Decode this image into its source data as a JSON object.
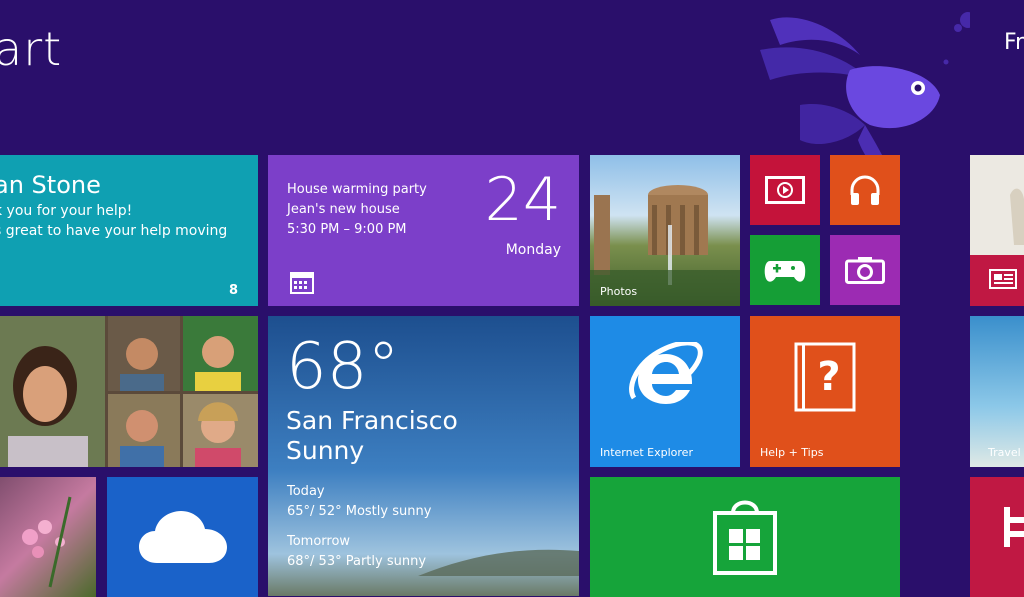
{
  "screen": {
    "title": "art",
    "user_name_partial": "Fr"
  },
  "tiles": {
    "mail": {
      "from": "an Stone",
      "line1": "k you for your help!",
      "line2": "s great to have your help moving",
      "count": "8"
    },
    "calendar": {
      "event": "House warming party",
      "location": "Jean's new house",
      "time": "5:30 PM – 9:00 PM",
      "day": "24",
      "weekday": "Monday"
    },
    "photos": {
      "label": "Photos"
    },
    "weather": {
      "temp": "68°",
      "city": "San Francisco",
      "condition": "Sunny",
      "today_label": "Today",
      "today_forecast": "65°/ 52° Mostly sunny",
      "tomorrow_label": "Tomorrow",
      "tomorrow_forecast": "68°/ 53° Partly sunny"
    },
    "ie": {
      "label": "Internet Explorer"
    },
    "help": {
      "label": "Help + Tips"
    },
    "travel": {
      "label": "Travel"
    }
  },
  "icons": [
    "video-icon",
    "headphones-icon",
    "xbox-controller-icon",
    "camera-icon",
    "calendar-icon",
    "ie-logo-icon",
    "help-book-icon",
    "cloud-icon",
    "store-bag-icon",
    "news-icon"
  ],
  "colors": {
    "background": "#2a0f6b",
    "mail": "#0fa0b2",
    "calendar": "#7c3fc9",
    "video": "#c4133a",
    "music": "#e0501b",
    "games": "#159e36",
    "camera": "#9c2bb3",
    "ie": "#1e8be6",
    "store": "#16a43a",
    "onedrive": "#1a62c9"
  }
}
